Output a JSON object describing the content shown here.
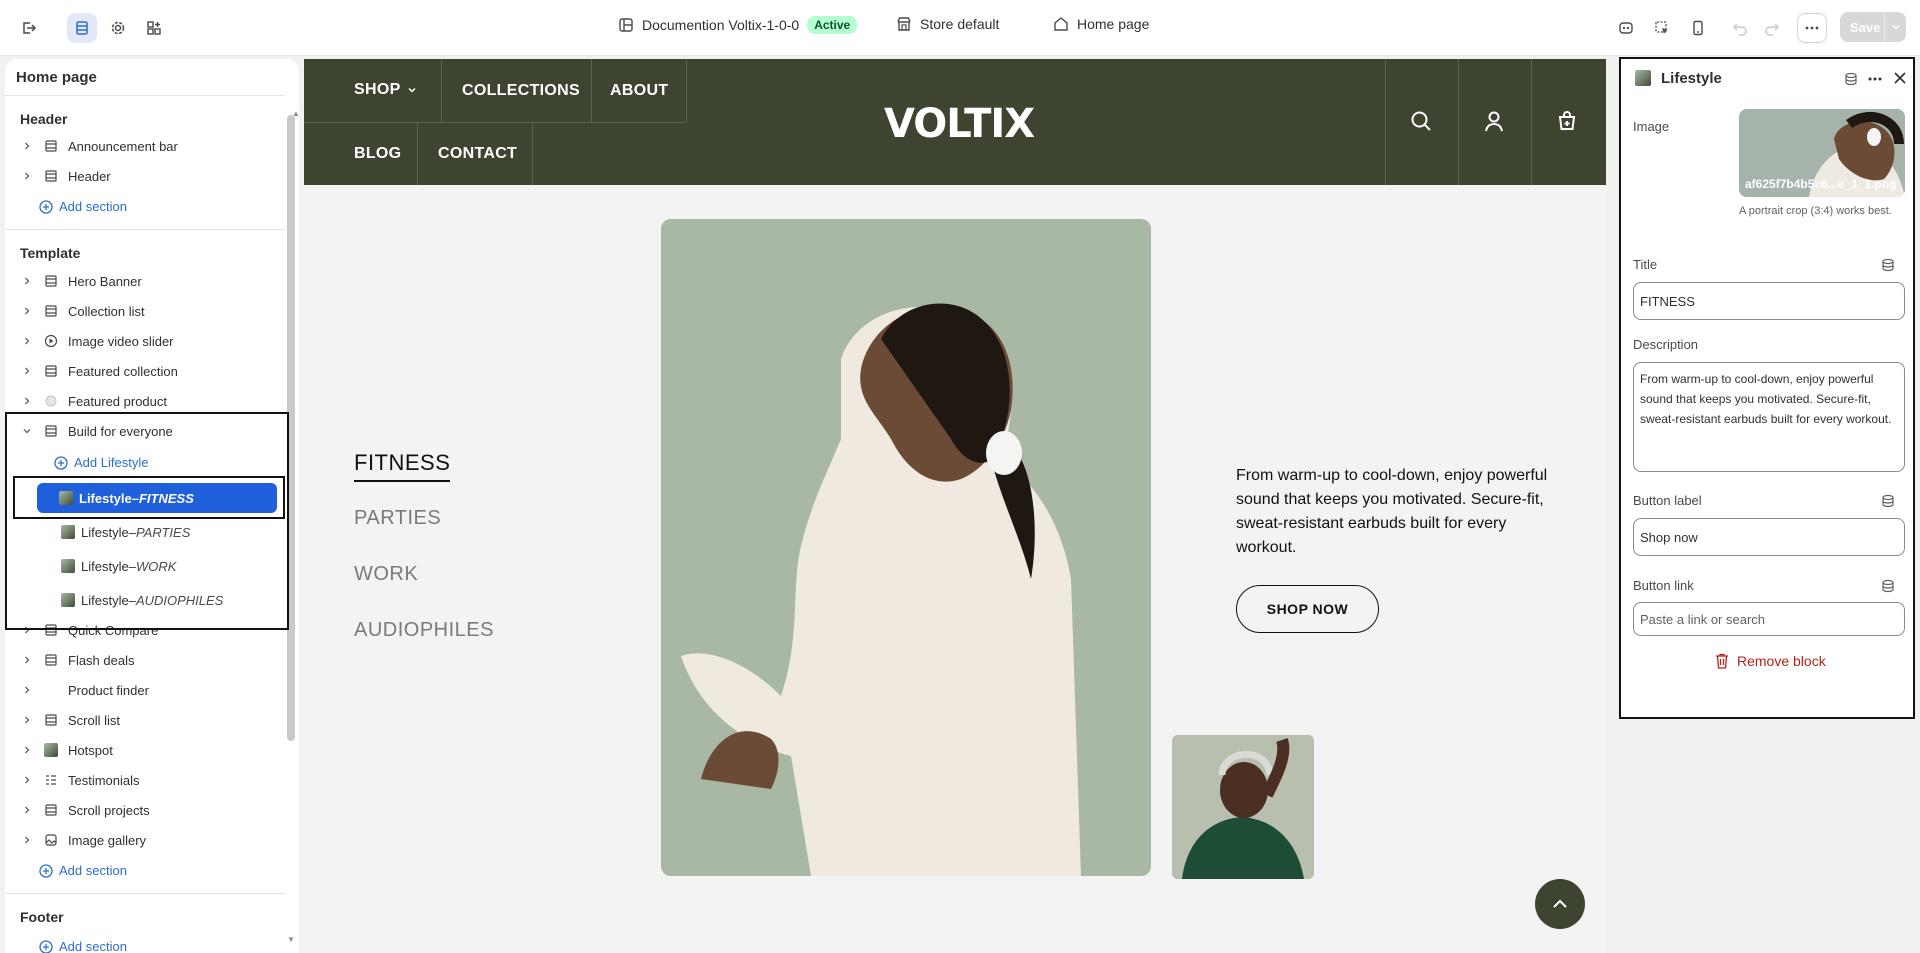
{
  "topbar": {
    "theme_name": "Documention Voltix-1-0-0",
    "status_badge": "Active",
    "store": "Store default",
    "page": "Home page",
    "save_label": "Save"
  },
  "sidebar": {
    "title": "Home page",
    "header_group": "Header",
    "header_items": [
      "Announcement bar",
      "Header"
    ],
    "add_section": "Add section",
    "template_group": "Template",
    "template_items": [
      "Hero Banner",
      "Collection list",
      "Image video slider",
      "Featured collection",
      "Featured product",
      "Build for everyone"
    ],
    "add_block": "Add Lifestyle",
    "blocks": [
      {
        "name": "Lifestyle",
        "sep": " – ",
        "detail": "FITNESS"
      },
      {
        "name": "Lifestyle",
        "sep": " – ",
        "detail": "PARTIES"
      },
      {
        "name": "Lifestyle",
        "sep": " – ",
        "detail": "WORK"
      },
      {
        "name": "Lifestyle",
        "sep": " – ",
        "detail": "AUDIOPHILES"
      }
    ],
    "more_items": [
      "Quick Compare",
      "Flash deals",
      "Product finder",
      "Scroll list",
      "Hotspot",
      "Testimonials",
      "Scroll projects",
      "Image gallery"
    ],
    "add_section_2": "Add section",
    "footer_group": "Footer",
    "add_section_3": "Add section"
  },
  "store": {
    "nav": [
      "SHOP",
      "COLLECTIONS",
      "ABOUT",
      "BLOG",
      "CONTACT"
    ],
    "logo": "VOLTIX",
    "tabs": [
      "FITNESS",
      "PARTIES",
      "WORK",
      "AUDIOPHILES"
    ],
    "description": "From warm-up to cool-down, enjoy powerful sound that keeps you motivated. Secure-fit, sweat-resistant earbuds built for every workout.",
    "button": "SHOP NOW"
  },
  "settings": {
    "title": "Lifestyle",
    "image_label": "Image",
    "image_filename": "af625f7b4b5c6...e_1_1.png",
    "image_help": "A portrait crop (3:4) works best.",
    "title_label": "Title",
    "title_value": "FITNESS",
    "description_label": "Description",
    "description_value": "From warm-up to cool-down, enjoy powerful sound that keeps you motivated. Secure-fit, sweat-resistant earbuds built for every workout.",
    "button_label_label": "Button label",
    "button_label_value": "Shop now",
    "button_link_label": "Button link",
    "button_link_placeholder": "Paste a link or search",
    "remove_label": "Remove block"
  },
  "colors": {
    "accent": "#1f5fdb",
    "store_nav": "#3d4430",
    "active_badge": "#b4fed2",
    "danger": "#b42318"
  }
}
